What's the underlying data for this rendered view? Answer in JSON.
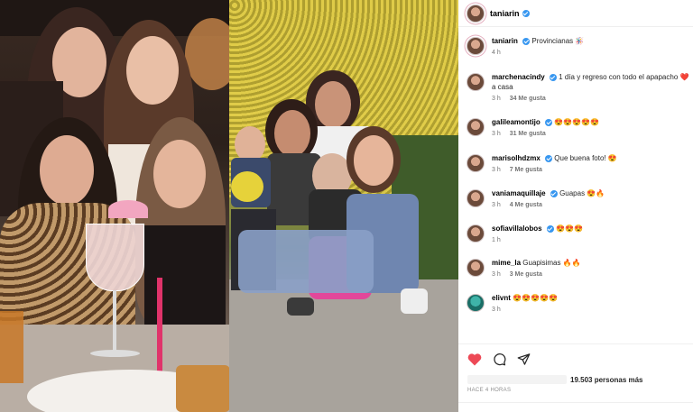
{
  "post": {
    "author": "taniarin",
    "caption_user": "taniarin",
    "caption_text": "Provincianas 🪅",
    "caption_time": "4 h"
  },
  "comments": [
    {
      "user": "marchenacindy",
      "text": "1 día y regreso con todo el apapacho ❤️ a casa",
      "time": "3 h",
      "likes": "34 Me gusta"
    },
    {
      "user": "galileamontijo",
      "text": "😍😍😍😍😍",
      "time": "3 h",
      "likes": "31 Me gusta"
    },
    {
      "user": "marisolhdzmx",
      "text": "Que buena foto! 😍",
      "time": "3 h",
      "likes": "7 Me gusta"
    },
    {
      "user": "vaniamaquillaje",
      "text": "Guapas 😍🔥",
      "time": "3 h",
      "likes": "4 Me gusta"
    },
    {
      "user": "sofiavillalobos",
      "text": "😍😍😍",
      "time": "1 h",
      "likes": ""
    },
    {
      "user": "mime_la",
      "text": "Guapisimas 🔥🔥",
      "time": "3 h",
      "likes": "3 Me gusta"
    },
    {
      "user": "elivnt",
      "text": "😍😍😍😍😍",
      "time": "3 h",
      "likes": ""
    }
  ],
  "actions": {
    "like_icon": "heart-icon",
    "comment_icon": "comment-icon",
    "share_icon": "share-icon",
    "like_color": "#ed4956"
  },
  "likes_summary": "19.503 personas más",
  "time_ago": "Hace 4 horas"
}
